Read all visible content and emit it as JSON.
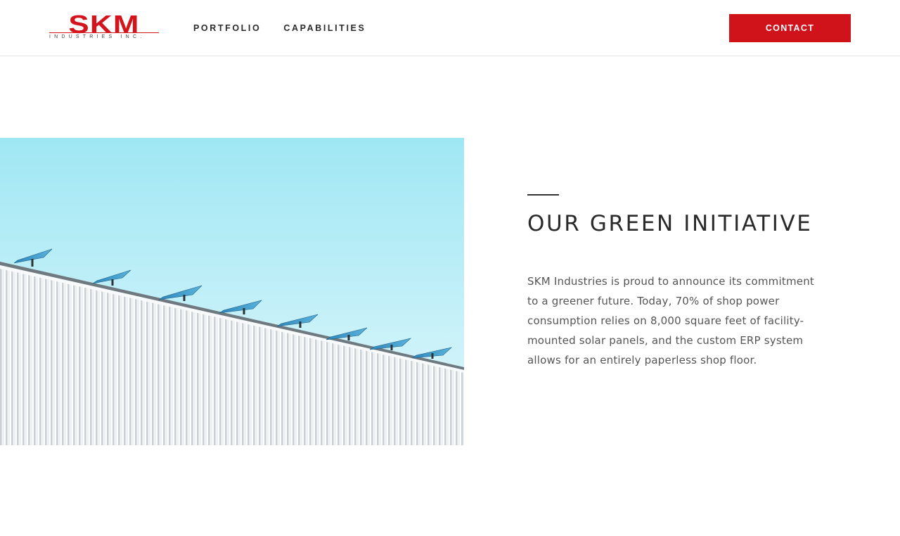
{
  "header": {
    "logo": {
      "mark": "SKM",
      "subtitle": "INDUSTRIES INC."
    },
    "nav": [
      {
        "label": "PORTFOLIO"
      },
      {
        "label": "CAPABILITIES"
      }
    ],
    "contact_label": "CONTACT"
  },
  "section": {
    "image_alt": "Corrugated white building wall with rooftop solar panels against a light blue sky",
    "title": "OUR GREEN INITIATIVE",
    "body": "SKM Industries is proud to announce its commitment to a greener future. Today, 70% of shop power consumption relies on 8,000 square feet of facility-mounted solar panels, and the custom ERP system allows for an entirely paperless shop floor."
  },
  "colors": {
    "brand_red": "#d0121b",
    "sky_top": "#9fe7f4",
    "sky_bottom": "#e2f7fb",
    "wall": "#e9eef0",
    "text_dark": "#2a2a2a",
    "text_body": "#555555"
  }
}
